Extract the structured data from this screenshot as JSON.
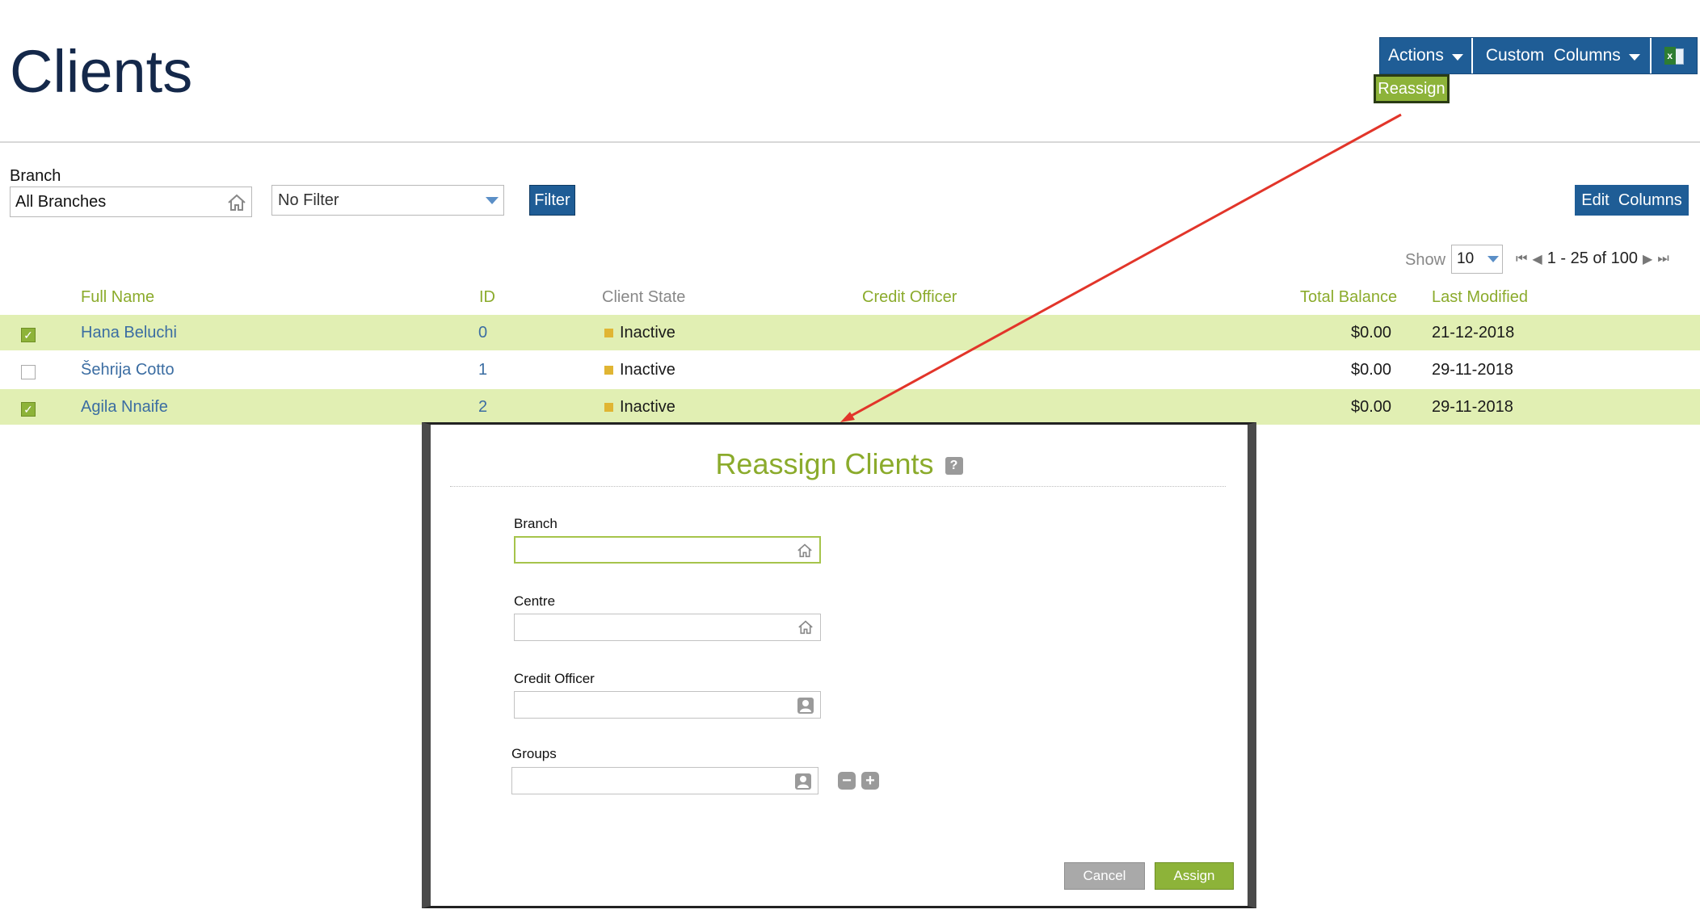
{
  "page": {
    "title": "Clients"
  },
  "toolbar": {
    "actions_label": "Actions",
    "custom_columns_label": "Custom  Columns",
    "export_icon": "excel-icon",
    "dropdown_item": "Reassign"
  },
  "filters": {
    "branch_label": "Branch",
    "branch_value": "All Branches",
    "filter_select_value": "No Filter",
    "filter_button": "Filter",
    "edit_columns_button": "Edit  Columns"
  },
  "pagination": {
    "show_label": "Show",
    "page_size": "10",
    "range_text": "1 - 25 of 100"
  },
  "table": {
    "columns": [
      "Full Name",
      "ID",
      "Client State",
      "Credit Officer",
      "Total Balance",
      "Last Modified"
    ],
    "rows": [
      {
        "checked": true,
        "name": "Hana Beluchi",
        "id": "0",
        "state": "Inactive",
        "officer": "",
        "balance": "$0.00",
        "modified": "21-12-2018"
      },
      {
        "checked": false,
        "name": "Šehrija Cotto",
        "id": "1",
        "state": "Inactive",
        "officer": "",
        "balance": "$0.00",
        "modified": "29-11-2018"
      },
      {
        "checked": true,
        "name": "Agila Nnaife",
        "id": "2",
        "state": "Inactive",
        "officer": "",
        "balance": "$0.00",
        "modified": "29-11-2018"
      }
    ]
  },
  "modal": {
    "title": "Reassign Clients",
    "help_icon": "?",
    "fields": [
      {
        "label": "Branch",
        "value": "",
        "icon": "home-icon"
      },
      {
        "label": "Centre",
        "value": "",
        "icon": "home-icon"
      },
      {
        "label": "Credit Officer",
        "value": "",
        "icon": "person-icon"
      },
      {
        "label": "Groups",
        "value": "",
        "icon": "person-icon"
      }
    ],
    "cancel_button": "Cancel",
    "assign_button": "Assign"
  },
  "colors": {
    "brand_blue": "#1f5d96",
    "accent_green": "#8db339",
    "header_green": "#8bab2c",
    "selected_row": "#e1efb3",
    "annotation_arrow": "#e2352a"
  }
}
